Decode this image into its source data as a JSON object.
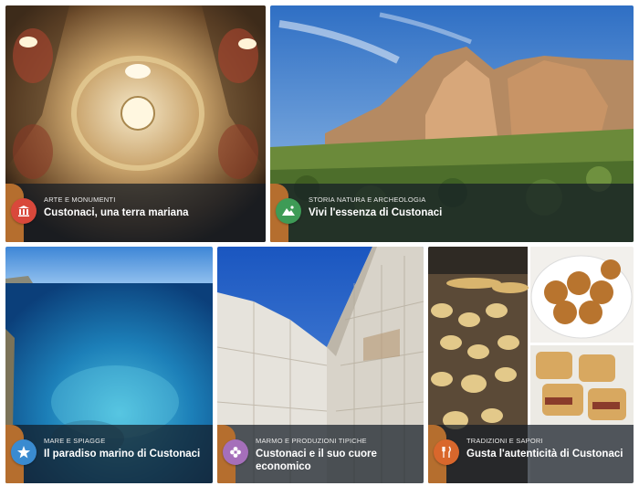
{
  "colors": {
    "tab": "#b56e2e",
    "badge_art": "#d9483b",
    "badge_nature": "#3e9b56",
    "badge_sea": "#3a8bd0",
    "badge_marble": "#a56fba",
    "badge_food": "#d9672c"
  },
  "cards": [
    {
      "category": "ARTE E MONUMENTI",
      "title": "Custonaci, una terra mariana",
      "icon": "monument-icon"
    },
    {
      "category": "STORIA NATURA E ARCHEOLOGIA",
      "title": "Vivi l'essenza di Custonaci",
      "icon": "mountain-icon"
    },
    {
      "category": "MARE E SPIAGGE",
      "title": "Il paradiso marino di Custonaci",
      "icon": "starfish-icon"
    },
    {
      "category": "MARMO E PRODUZIONI TIPICHE",
      "title": "Custonaci e il suo cuore economico",
      "icon": "flower-icon"
    },
    {
      "category": "TRADIZIONI E SAPORI",
      "title": "Gusta l'autenticità di Custonaci",
      "icon": "fork-knife-icon"
    }
  ]
}
